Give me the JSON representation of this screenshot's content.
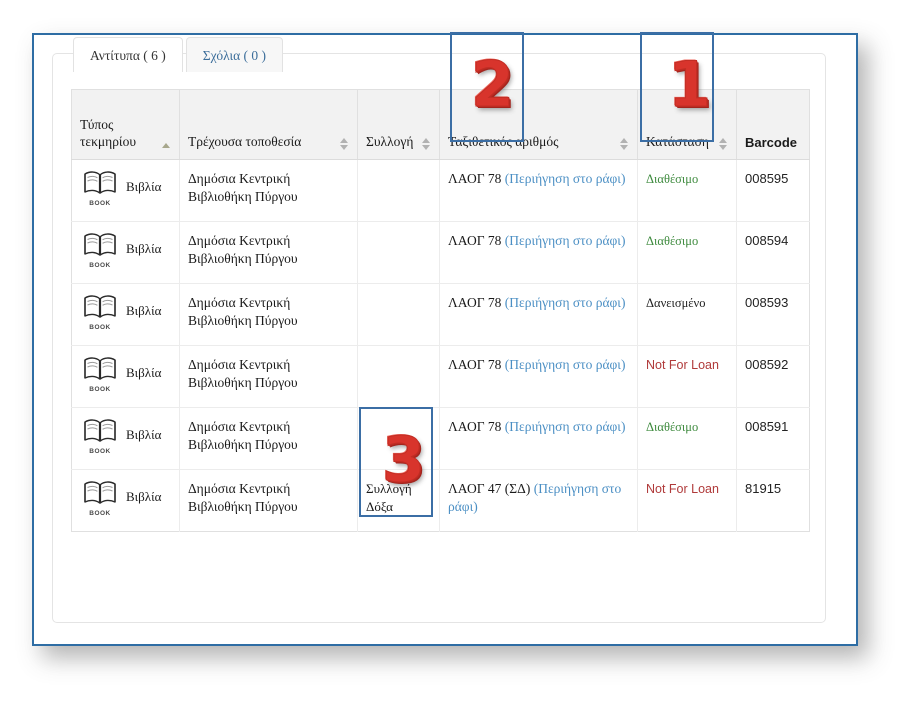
{
  "tabs": [
    {
      "label": "Αντίτυπα ( 6 )",
      "active": true
    },
    {
      "label": "Σχόλια ( 0 )",
      "active": false
    }
  ],
  "table": {
    "columns": [
      {
        "label": "Τύπος τεκμηρίου",
        "sort": "asc"
      },
      {
        "label": "Τρέχουσα τοποθεσία",
        "sort": "both"
      },
      {
        "label": "Συλλογή",
        "sort": "both"
      },
      {
        "label": "Ταξιθετικός αριθμός",
        "sort": "both"
      },
      {
        "label": "Κατάσταση",
        "sort": "both"
      },
      {
        "label": "Barcode",
        "sort": "none"
      }
    ],
    "rows": [
      {
        "item_type": "Βιβλία",
        "icon_caption": "BOOK",
        "location": "Δημόσια Κεντρική Βιβλιοθήκη Πύργου",
        "collection": "",
        "callnumber": "ΛΑΟΓ 78",
        "browse_link": "(Περιήγηση στο ράφι)",
        "status": "Διαθέσιμο",
        "status_kind": "available",
        "barcode": "008595"
      },
      {
        "item_type": "Βιβλία",
        "icon_caption": "BOOK",
        "location": "Δημόσια Κεντρική Βιβλιοθήκη Πύργου",
        "collection": "",
        "callnumber": "ΛΑΟΓ 78",
        "browse_link": "(Περιήγηση στο ράφι)",
        "status": "Διαθέσιμο",
        "status_kind": "available",
        "barcode": "008594"
      },
      {
        "item_type": "Βιβλία",
        "icon_caption": "BOOK",
        "location": "Δημόσια Κεντρική Βιβλιοθήκη Πύργου",
        "collection": "",
        "callnumber": "ΛΑΟΓ 78",
        "browse_link": "(Περιήγηση στο ράφι)",
        "status": "Δανεισμένο",
        "status_kind": "checkedout",
        "barcode": "008593"
      },
      {
        "item_type": "Βιβλία",
        "icon_caption": "BOOK",
        "location": "Δημόσια Κεντρική Βιβλιοθήκη Πύργου",
        "collection": "",
        "callnumber": "ΛΑΟΓ 78",
        "browse_link": "(Περιήγηση στο ράφι)",
        "status": "Not For Loan",
        "status_kind": "notforloan",
        "barcode": "008592"
      },
      {
        "item_type": "Βιβλία",
        "icon_caption": "BOOK",
        "location": "Δημόσια Κεντρική Βιβλιοθήκη Πύργου",
        "collection": "",
        "callnumber": "ΛΑΟΓ 78",
        "browse_link": "(Περιήγηση στο ράφι)",
        "status": "Διαθέσιμο",
        "status_kind": "available",
        "barcode": "008591"
      },
      {
        "item_type": "Βιβλία",
        "icon_caption": "BOOK",
        "location": "Δημόσια Κεντρική Βιβλιοθήκη Πύργου",
        "collection": "Συλλογή Δόξα",
        "callnumber": "ΛΑΟΓ 47 (ΣΔ)",
        "browse_link": "(Περιήγηση στο ράφι)",
        "status": "Not For Loan",
        "status_kind": "notforloan",
        "barcode": "81915"
      }
    ]
  },
  "annotations": [
    {
      "number": "1"
    },
    {
      "number": "2"
    },
    {
      "number": "3"
    }
  ],
  "colors": {
    "frame_blue": "#2e6da4",
    "callout_blue": "#3b6ea5",
    "callout_red": "#d8342c",
    "link_blue": "#4b8fc4",
    "status_available_green": "#3f8b3f",
    "status_notforloan_red": "#b03a3a",
    "header_gray": "#f2f2f2"
  }
}
